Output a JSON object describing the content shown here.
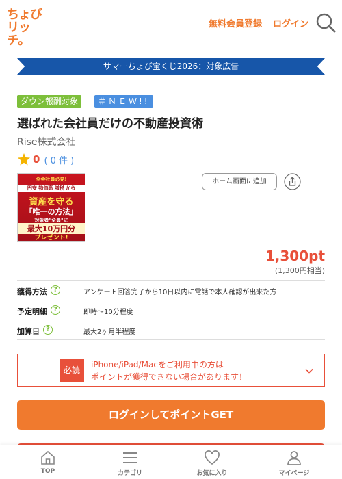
{
  "header": {
    "logo_line1": "ちょび",
    "logo_line2": "リッチ。",
    "register_label": "無料会員登録",
    "login_label": "ログイン",
    "search_icon": "search-icon"
  },
  "banner": {
    "text": "サマーちょび宝くじ2026：対象広告"
  },
  "tags": {
    "down": "ダウン報酬対象",
    "new": "＃ＮＥＷ!!"
  },
  "offer": {
    "title": "選ばれた会社員だけの不動産投資術",
    "company": "Rise株式会社",
    "rating_value": "0",
    "rating_count": "( 0 件 )"
  },
  "ad_image": {
    "line1": "全会社員必見!",
    "line2": "円安 物価高 増税 から",
    "line3": "資産を守る",
    "line4": "「唯一の方法」",
    "line5": "対象者\"全員\"に",
    "line6": "最大10万円分",
    "line7": "プレゼント!"
  },
  "actions": {
    "home_label": "ホーム画面に追加"
  },
  "points": {
    "value": "1,300pt",
    "yen": "(1,300円相当)"
  },
  "info_rows": [
    {
      "label": "獲得方法",
      "value": "アンケート回答完了から10日以内に電話で本人確認が出来た方"
    },
    {
      "label": "予定明細",
      "value": "即時～10分程度"
    },
    {
      "label": "加算日",
      "value": "最大2ヶ月半程度"
    }
  ],
  "notice": {
    "badge": "必読",
    "line1": "iPhone/iPad/Macをご利用中の方は",
    "line2": "ポイントが獲得できない場合があります！"
  },
  "cta": {
    "label": "ログインしてポイントGET"
  },
  "bottom_nav": [
    {
      "label": "TOP",
      "icon": "home-icon"
    },
    {
      "label": "カテゴリ",
      "icon": "menu-icon"
    },
    {
      "label": "お気に入り",
      "icon": "heart-icon"
    },
    {
      "label": "マイページ",
      "icon": "person-icon"
    }
  ],
  "colors": {
    "accent": "#f07a2e",
    "red": "#e8503a",
    "banner": "#1756a9",
    "green": "#7dbf3a",
    "blue": "#4a8fe0"
  }
}
